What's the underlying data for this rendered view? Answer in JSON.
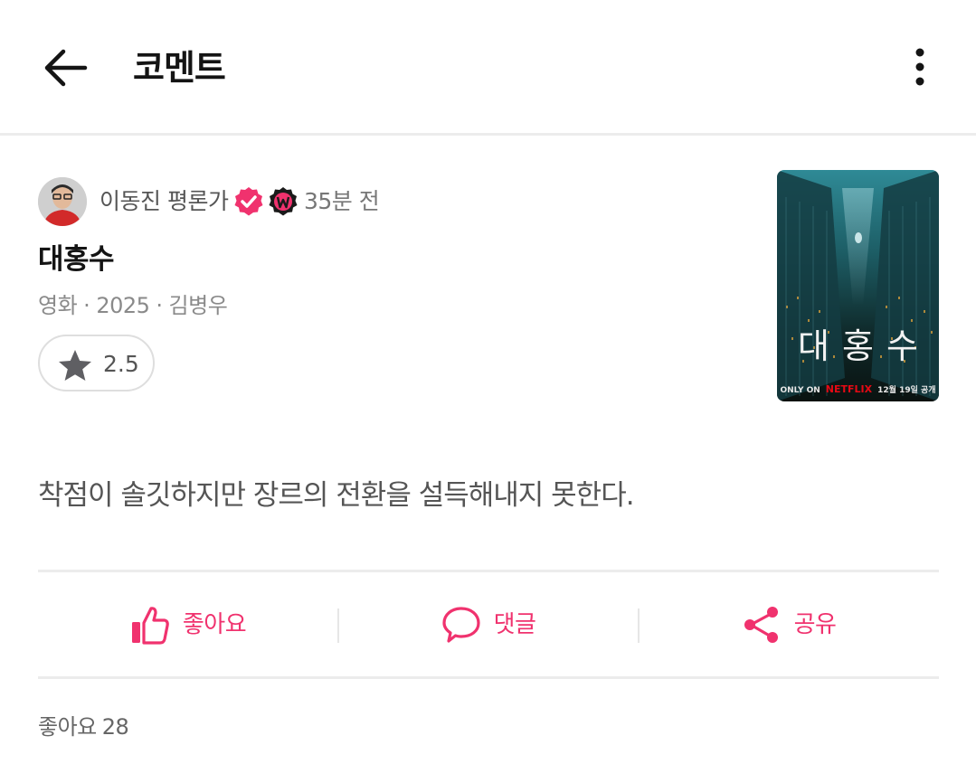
{
  "header": {
    "title": "코멘트",
    "back_icon": "arrow-left-icon",
    "more_icon": "more-vertical-icon"
  },
  "author": {
    "name": "이동진 평론가",
    "time_ago": "35분 전",
    "badges": [
      "verified-check-icon",
      "watcha-w-icon"
    ]
  },
  "movie": {
    "title": "대홍수",
    "type": "영화",
    "year": "2025",
    "director": "김병우",
    "poster": {
      "title": "대홍수",
      "only_on": "ONLY ON",
      "brand": "NETFLIX",
      "release": "12월 19일 공개"
    }
  },
  "rating": {
    "value": "2.5",
    "icon": "star-icon"
  },
  "comment": {
    "text": "착점이 솔깃하지만 장르의 전환을 설득해내지 못한다."
  },
  "actions": {
    "like_label": "좋아요",
    "comment_label": "댓글",
    "share_label": "공유"
  },
  "stats": {
    "likes_label": "좋아요",
    "likes_count": "28"
  },
  "colors": {
    "accent": "#f0326e",
    "poster_top": "#2b7f8c",
    "poster_bottom": "#0b1512"
  }
}
